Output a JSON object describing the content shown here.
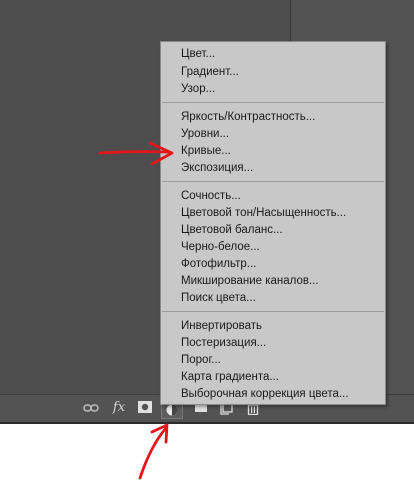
{
  "menu": {
    "groups": [
      [
        "Цвет...",
        "Градиент...",
        "Узор..."
      ],
      [
        "Яркость/Контрастность...",
        "Уровни...",
        "Кривые...",
        "Экспозиция..."
      ],
      [
        "Сочность...",
        "Цветовой тон/Насыщенность...",
        "Цветовой баланс...",
        "Черно-белое...",
        "Фотофильтр...",
        "Микширование каналов...",
        "Поиск цвета..."
      ],
      [
        "Инвертировать",
        "Постеризация...",
        "Порог...",
        "Карта градиента...",
        "Выборочная коррекция цвета..."
      ]
    ]
  },
  "toolbar": {
    "icons": [
      "link-icon",
      "fx-icon",
      "layer-mask-icon",
      "adjustment-layer-icon",
      "group-folder-icon",
      "new-layer-icon",
      "trash-icon"
    ],
    "fx_label": "fx"
  },
  "annotations": {
    "arrow_color": "#e3161b"
  },
  "colors": {
    "workspace": "#535353",
    "menu_bg": "#c8c8c8"
  }
}
